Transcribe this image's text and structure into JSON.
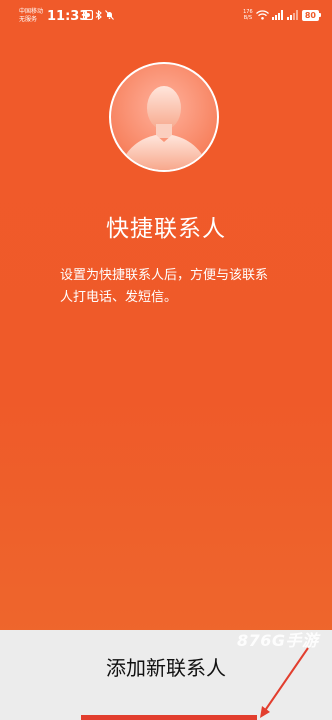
{
  "status_bar": {
    "carrier_line1": "中国移动",
    "carrier_line2": "无服务",
    "time": "11:33",
    "speed_line1": "176",
    "speed_line2": "B/S",
    "battery": "80"
  },
  "title": "快捷联系人",
  "description": "设置为快捷联系人后，方便与该联系人打电话、发短信。",
  "add_button_label": "添加新联系人",
  "watermark": "876G手游",
  "colors": {
    "background": "#ef5a29",
    "bottom_panel": "#ececec",
    "annotation": "#e23e2e"
  }
}
